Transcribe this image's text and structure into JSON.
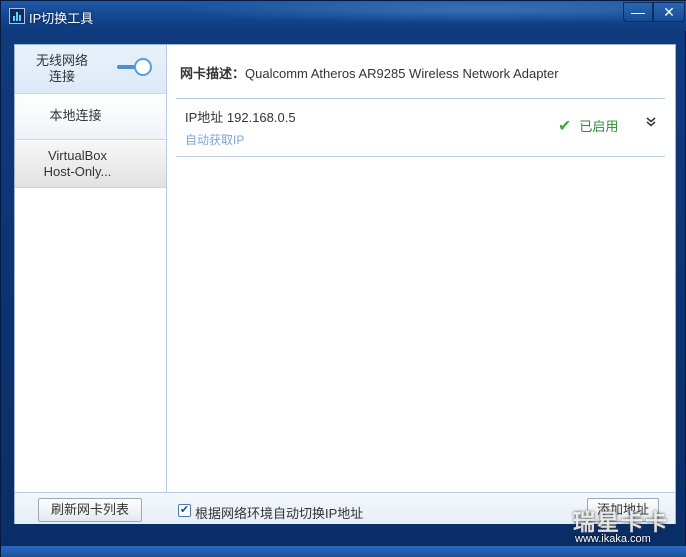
{
  "window": {
    "title": "IP切换工具",
    "minimize_glyph": "—",
    "close_glyph": "✕"
  },
  "sidebar": {
    "items": [
      {
        "label": "无线网络\n连接",
        "active": true,
        "toggle": "on"
      },
      {
        "label": "本地连接",
        "active": false
      },
      {
        "label": "VirtualBox\nHost-Only...",
        "active": false
      }
    ]
  },
  "main": {
    "nic_label": "网卡描述：",
    "nic_value": "Qualcomm Atheros AR9285 Wireless Network Adapter",
    "ip_entry": {
      "ip_label": "IP地址 192.168.0.5",
      "mode": "自动获取IP",
      "status": "已启用",
      "status_icon": "check-icon",
      "expand_icon": "double-chevron-down-icon",
      "expand_glyph": "⌄"
    }
  },
  "footer": {
    "refresh_label": "刷新网卡列表",
    "auto_switch_label": "根据网络环境自动切换IP地址",
    "auto_switch_checked": true,
    "add_label": "添加地址"
  },
  "watermark": {
    "logo": "瑞星卡卡",
    "url": "www.ikaka.com"
  },
  "colors": {
    "frame": "#0f3a7d",
    "accent": "#4a8fd6",
    "status_green": "#2f8a2f",
    "link_blue": "#7fa7d6"
  }
}
